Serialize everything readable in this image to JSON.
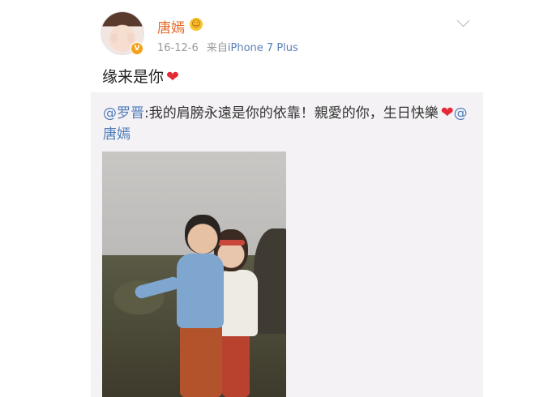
{
  "post": {
    "username": "唐嫣",
    "crown_badge": "☺",
    "verified_badge": "V",
    "date": "16-12-6",
    "source_prefix": "来自",
    "device": "iPhone 7 Plus",
    "text": "缘来是你",
    "text_emoji": "❤"
  },
  "repost": {
    "author_mention": "@罗晋",
    "text_part1": ":我的肩膀永遠是你的依靠！親愛的你，生日快樂",
    "emoji": "❤",
    "reply_mention": "@唐嫣"
  },
  "icons": {
    "menu": "chevron-down-icon",
    "verified": "verified-icon",
    "crown": "crown-icon",
    "heart": "heart-icon"
  },
  "colors": {
    "username": "#e46a28",
    "mention": "#4f7dbb",
    "heart": "#e52a36",
    "repost_bg": "#f4f2f4"
  }
}
